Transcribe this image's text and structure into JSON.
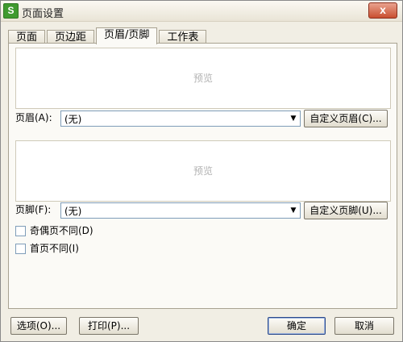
{
  "window": {
    "title": "页面设置",
    "app_icon_letter": "S",
    "close_label": "x"
  },
  "tabs": [
    {
      "label": "页面",
      "active": false
    },
    {
      "label": "页边距",
      "active": false
    },
    {
      "label": "页眉/页脚",
      "active": true
    },
    {
      "label": "工作表",
      "active": false
    }
  ],
  "header": {
    "preview_text": "预览",
    "label": "页眉(A):",
    "value": "(无)",
    "custom_button": "自定义页眉(C)..."
  },
  "footer": {
    "preview_text": "预览",
    "label": "页脚(F):",
    "value": "(无)",
    "custom_button": "自定义页脚(U)..."
  },
  "options": {
    "odd_even": {
      "label": "奇偶页不同(D)",
      "checked": false
    },
    "first_page": {
      "label": "首页不同(I)",
      "checked": false
    }
  },
  "buttons": {
    "options": "选项(O)...",
    "print": "打印(P)...",
    "ok": "确定",
    "cancel": "取消"
  }
}
